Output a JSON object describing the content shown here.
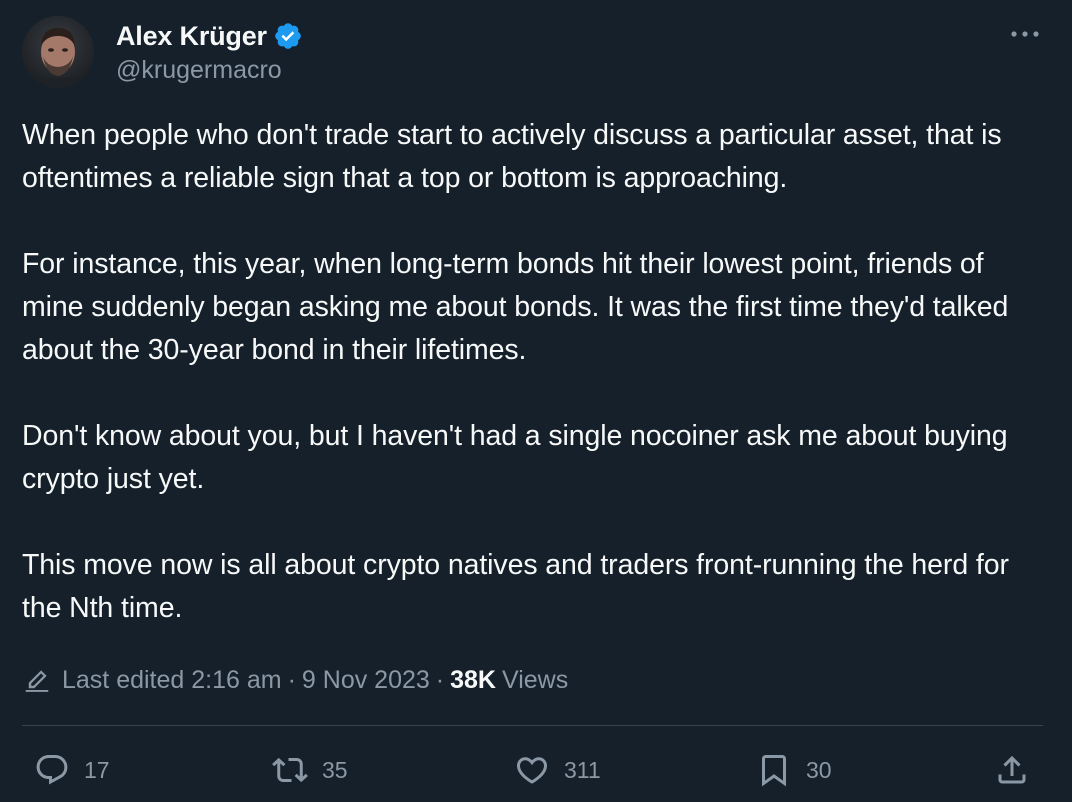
{
  "author": {
    "display_name": "Alex Krüger",
    "handle": "@krugermacro",
    "verified": true,
    "avatar_icon": "avatar-photo"
  },
  "colors": {
    "background": "#15202b",
    "text_primary": "#f7f9f9",
    "text_secondary": "#8b98a5",
    "verified_badge": "#1d9bf0",
    "divider": "#38444d"
  },
  "menu_icon": "more-horizontal-icon",
  "body": {
    "paragraphs": [
      "When people who don't trade start to actively discuss a particular asset, that is oftentimes a reliable sign that a top or bottom is approaching.",
      "For instance, this year, when long-term bonds hit their lowest point, friends of mine suddenly began asking me about bonds. It was the first time they'd talked about the 30-year bond in their lifetimes.",
      "Don't know about you, but I haven't had a single nocoiner ask me about buying crypto just yet.",
      "This move now is all about crypto natives and traders front-running the herd for the Nth time."
    ]
  },
  "meta": {
    "edited_label": "Last edited 2:16 am",
    "separator": "·",
    "date": "9 Nov 2023",
    "views_count": "38K",
    "views_label": "Views"
  },
  "actions": {
    "reply": {
      "icon": "reply-icon",
      "count": "17"
    },
    "retweet": {
      "icon": "retweet-icon",
      "count": "35"
    },
    "like": {
      "icon": "heart-icon",
      "count": "311"
    },
    "bookmark": {
      "icon": "bookmark-icon",
      "count": "30"
    },
    "share": {
      "icon": "share-icon"
    }
  }
}
